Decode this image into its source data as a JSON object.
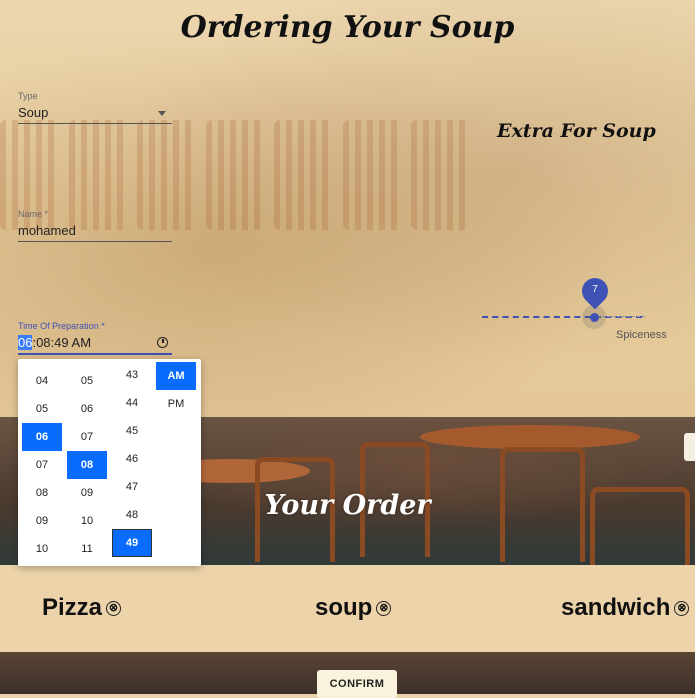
{
  "page": {
    "title": "Ordering Your Soup",
    "extra_heading": "Extra For Soup"
  },
  "form": {
    "type": {
      "label": "Type",
      "value": "Soup"
    },
    "name": {
      "label": "Name *",
      "value": "mohamed"
    },
    "time": {
      "label": "Time Of Preparation *",
      "hour": "06",
      "rest": ":08:49",
      "ampm": "AM"
    }
  },
  "slider": {
    "label": "Spiceness",
    "value": "7",
    "level": 7
  },
  "picker": {
    "hours": [
      "04",
      "05",
      "06",
      "07",
      "08",
      "09",
      "10"
    ],
    "minutes": [
      "05",
      "06",
      "07",
      "08",
      "09",
      "10",
      "11"
    ],
    "seconds": [
      "43",
      "44",
      "45",
      "46",
      "47",
      "48",
      "49"
    ],
    "ampm": [
      "AM",
      "PM"
    ]
  },
  "order": {
    "heading": "Your Order",
    "items": [
      {
        "label": "Pizza"
      },
      {
        "label": "soup"
      },
      {
        "label": "sandwich"
      }
    ],
    "remove_icon": "⊗"
  },
  "confirm_label": "CONFIRM",
  "colors": {
    "accent": "#3f51b5",
    "selected": "#0a6cff",
    "background": "#ecd3a9"
  }
}
